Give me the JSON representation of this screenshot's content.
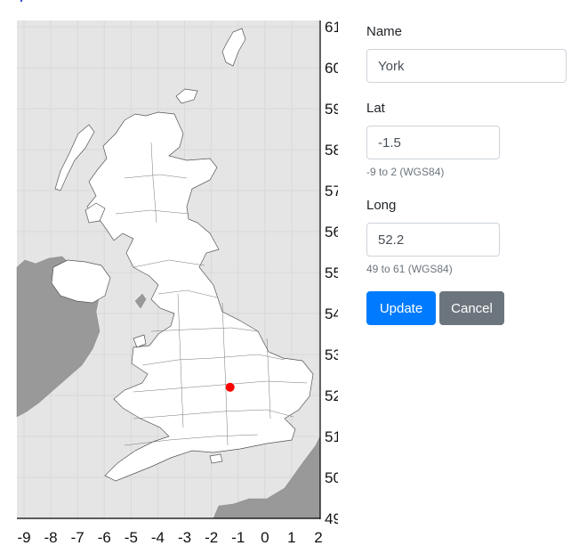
{
  "form": {
    "name_label": "Name",
    "name_value": "York",
    "lat_label": "Lat",
    "lat_value": "-1.5",
    "lat_help": "-9 to 2 (WGS84)",
    "long_label": "Long",
    "long_value": "52.2",
    "long_help": "49 to 61 (WGS84)",
    "update_label": "Update",
    "cancel_label": "Cancel"
  },
  "map": {
    "x_ticks": [
      "-9",
      "-8",
      "-7",
      "-6",
      "-5",
      "-4",
      "-3",
      "-2",
      "-1",
      "0",
      "1",
      "2"
    ],
    "y_ticks": [
      "61",
      "60",
      "59",
      "58",
      "57",
      "56",
      "55",
      "54",
      "53",
      "52",
      "51",
      "50",
      "49"
    ],
    "marker_lon": -1.3,
    "marker_lat": 52.2,
    "colors": {
      "sea": "#e5e5e5",
      "land": "#ffffff",
      "other_land": "#999999",
      "marker": "#ff0000"
    }
  }
}
